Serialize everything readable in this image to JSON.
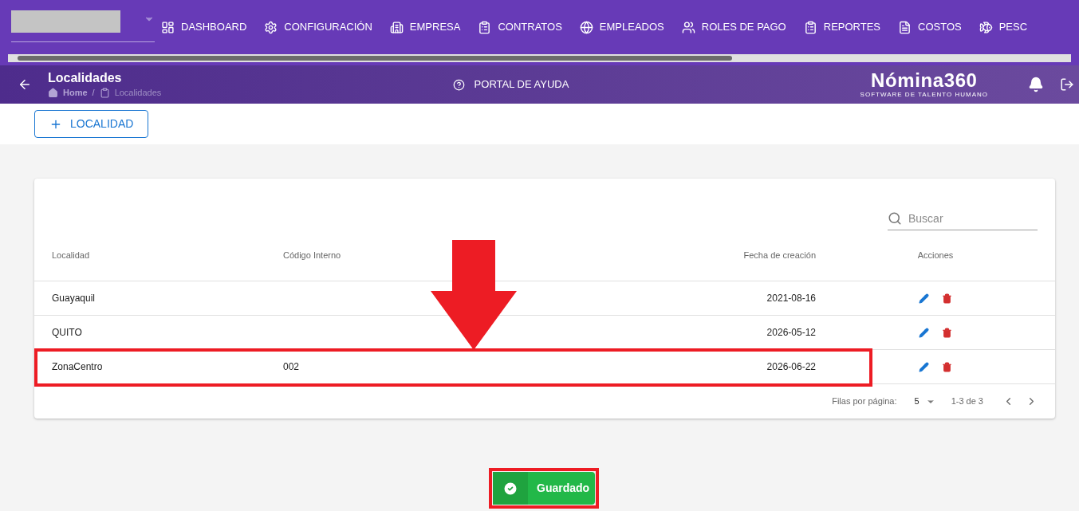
{
  "nav": [
    {
      "label": "DASHBOARD"
    },
    {
      "label": "CONFIGURACIÓN"
    },
    {
      "label": "EMPRESA"
    },
    {
      "label": "CONTRATOS"
    },
    {
      "label": "EMPLEADOS"
    },
    {
      "label": "ROLES DE PAGO"
    },
    {
      "label": "REPORTES"
    },
    {
      "label": "COSTOS"
    },
    {
      "label": "PESC"
    }
  ],
  "header": {
    "title": "Localidades",
    "breadcrumb": [
      "Home",
      "Localidades"
    ],
    "breadcrumb_separator": "/",
    "help": "PORTAL DE AYUDA",
    "logo": "Nómina360",
    "logo_tagline": "SOFTWARE DE TALENTO HUMANO"
  },
  "add_button": "LOCALIDAD",
  "search": {
    "placeholder": "Buscar"
  },
  "table": {
    "columns": [
      "Localidad",
      "Código Interno",
      "Fecha de creación",
      "Acciones"
    ],
    "rows": [
      {
        "cells": [
          "Guayaquil",
          "",
          "2021-08-16"
        ],
        "highlighted": false
      },
      {
        "cells": [
          "QUITO",
          "",
          "2026-05-12"
        ],
        "highlighted": false
      },
      {
        "cells": [
          "ZonaCentro",
          "002",
          "2026-06-22"
        ],
        "highlighted": true
      }
    ]
  },
  "pagination": {
    "label": "Filas por página:",
    "per_page": "5",
    "range": "1-3 de 3"
  },
  "toast": {
    "text": "Guardado"
  }
}
